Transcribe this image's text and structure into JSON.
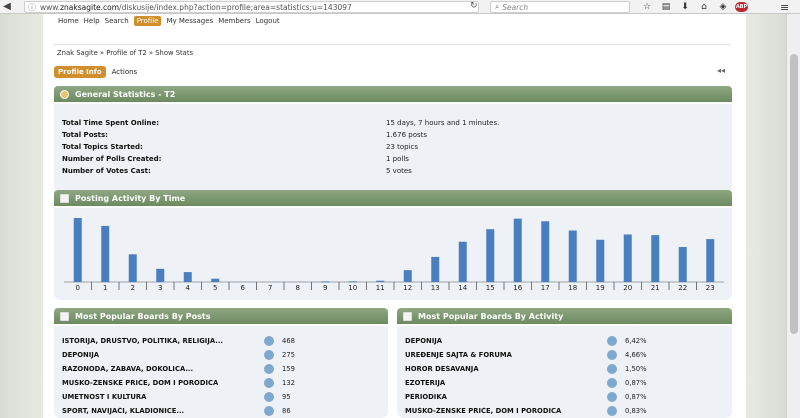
{
  "browser": {
    "url_prefix": "www.",
    "url_domain": "znaksagite.com",
    "url_rest": "/diskusije/index.php?action=profile;area=statistics;u=143097",
    "search_placeholder": "Search",
    "adblock_label": "ABP"
  },
  "topmenu": [
    "Home",
    "Help",
    "Search",
    "Profile",
    "My Messages",
    "Members",
    "Logout"
  ],
  "topmenu_active": "Profile",
  "breadcrumb": "Znak Sagite » Profile of T2 » Show Stats",
  "tabs": {
    "active": "Profile Info",
    "other": "Actions"
  },
  "general": {
    "title": "General Statistics - T2",
    "rows": [
      {
        "label": "Total Time Spent Online:",
        "value": "15 days, 7 hours and 1 minutes."
      },
      {
        "label": "Total Posts:",
        "value": "1.676 posts"
      },
      {
        "label": "Total Topics Started:",
        "value": "23 topics"
      },
      {
        "label": "Number of Polls Created:",
        "value": "1 polls"
      },
      {
        "label": "Number of Votes Cast:",
        "value": "5 votes"
      }
    ]
  },
  "activity": {
    "title": "Posting Activity By Time"
  },
  "chart_data": {
    "type": "bar",
    "title": "Posting Activity By Time",
    "categories": [
      "0",
      "1",
      "2",
      "3",
      "4",
      "5",
      "6",
      "7",
      "8",
      "9",
      "10",
      "11",
      "12",
      "13",
      "14",
      "15",
      "16",
      "17",
      "18",
      "19",
      "20",
      "21",
      "22",
      "23"
    ],
    "values": [
      97,
      85,
      42,
      20,
      15,
      5,
      0,
      0,
      0,
      1,
      1,
      2,
      18,
      38,
      61,
      80,
      96,
      92,
      78,
      64,
      72,
      71,
      53,
      65
    ],
    "ylim": [
      0,
      100
    ],
    "grid": false
  },
  "boards_posts": {
    "title": "Most Popular Boards By Posts",
    "rows": [
      {
        "name": "ISTORIJA, DRUŠTVO, POLITIKA, RELIGIJA...",
        "value": "468"
      },
      {
        "name": "DEPONIJA",
        "value": "275"
      },
      {
        "name": "RAZONODA, ZABAVA, DOKOLICA...",
        "value": "159"
      },
      {
        "name": "MUŠKO-ŽENSKE PRIČE, DOM I PORODICA",
        "value": "132"
      },
      {
        "name": "UMETNOST I KULTURA",
        "value": "95"
      },
      {
        "name": "SPORT, NAVIJAČI, KLADIONICE...",
        "value": "86"
      }
    ]
  },
  "boards_activity": {
    "title": "Most Popular Boards By Activity",
    "rows": [
      {
        "name": "DEPONIJA",
        "value": "6,42%"
      },
      {
        "name": "UREĐENJE SAJTA & FORUMA",
        "value": "4,66%"
      },
      {
        "name": "HOROR DEŠAVANJA",
        "value": "1,50%"
      },
      {
        "name": "EZOTERIJA",
        "value": "0,87%"
      },
      {
        "name": "PERIODIKA",
        "value": "0,87%"
      },
      {
        "name": "MUŠKO-ŽENSKE PRIČE, DOM I PORODICA",
        "value": "0,83%"
      }
    ]
  },
  "colors": {
    "accent": "#d08e2c",
    "category_bar": "#7a9a6d",
    "panel_bg": "#eef2f6",
    "chart_bar": "#4a7fbf"
  }
}
